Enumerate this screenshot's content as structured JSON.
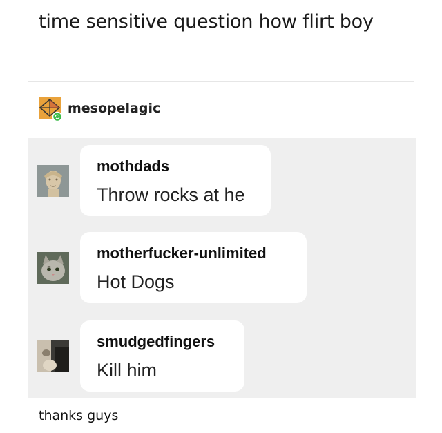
{
  "post": {
    "title": "time sensitive question how flirt boy"
  },
  "reblog": {
    "username": "mesopelagic",
    "avatar_icon": "geometric-avatar-icon",
    "badge_icon": "reblog-badge-icon",
    "badge_color": "#3dbb4a"
  },
  "replies": [
    {
      "username": "mothdads",
      "message": "Throw rocks at he",
      "avatar_icon": "statue-avatar-icon"
    },
    {
      "username": "motherfucker-unlimited",
      "message": "Hot Dogs",
      "avatar_icon": "cat-avatar-icon"
    },
    {
      "username": "smudgedfingers",
      "message": "Kill him",
      "avatar_icon": "photo-avatar-icon"
    }
  ],
  "footer": {
    "text": "thanks guys"
  }
}
